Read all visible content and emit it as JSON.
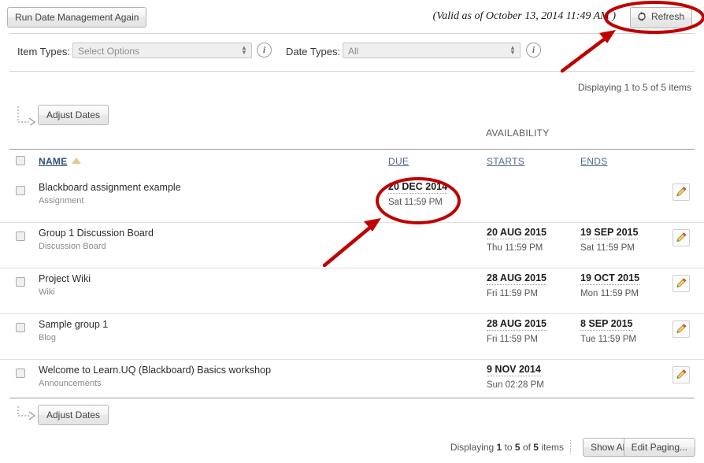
{
  "toolbar": {
    "run_again_label": "Run Date Management Again",
    "valid_as_of": "(Valid as of October 13, 2014 11:49 AM )",
    "refresh_label": "Refresh",
    "refresh_icon": "refresh-circular-arrows-icon"
  },
  "filters": {
    "item_types_label": "Item Types:",
    "item_types_value": "Select Options",
    "date_types_label": "Date Types:",
    "date_types_value": "All",
    "info_icon": "information-icon"
  },
  "paging": {
    "top_text": "Displaying 1 to 5 of 5 items",
    "bottom_prefix": "Displaying ",
    "bottom_from": "1",
    "bottom_mid": " to ",
    "bottom_to": "5",
    "bottom_mid2": " of ",
    "bottom_total": "5",
    "bottom_suffix": " items",
    "show_all_label": "Show All",
    "edit_paging_label": "Edit Paging..."
  },
  "actions": {
    "adjust_dates_label": "Adjust Dates",
    "elbow_icon": "dotted-elbow-arrow-icon",
    "edit_icon": "pencil-edit-icon"
  },
  "table": {
    "group_header": "AVAILABILITY",
    "columns": {
      "name": "NAME",
      "due": "DUE",
      "starts": "STARTS",
      "ends": "ENDS"
    },
    "sort_icon": "sort-ascending-triangle-icon",
    "rows": [
      {
        "title": "Blackboard assignment example",
        "type": "Assignment",
        "due_date": "20 DEC 2014",
        "due_time": "Sat 11:59 PM",
        "starts_date": "",
        "starts_time": "",
        "ends_date": "",
        "ends_time": ""
      },
      {
        "title": "Group 1 Discussion Board",
        "type": "Discussion Board",
        "due_date": "",
        "due_time": "",
        "starts_date": "20 AUG 2015",
        "starts_time": "Thu 11:59 PM",
        "ends_date": "19 SEP 2015",
        "ends_time": "Sat 11:59 PM"
      },
      {
        "title": "Project Wiki",
        "type": "Wiki",
        "due_date": "",
        "due_time": "",
        "starts_date": "28 AUG 2015",
        "starts_time": "Fri 11:59 PM",
        "ends_date": "19 OCT 2015",
        "ends_time": "Mon 11:59 PM"
      },
      {
        "title": "Sample group 1",
        "type": "Blog",
        "due_date": "",
        "due_time": "",
        "starts_date": "28 AUG 2015",
        "starts_time": "Fri 11:59 PM",
        "ends_date": "8 SEP 2015",
        "ends_time": "Tue 11:59 PM"
      },
      {
        "title": "Welcome to Learn.UQ (Blackboard) Basics workshop",
        "type": "Announcements",
        "due_date": "",
        "due_time": "",
        "starts_date": "9 NOV 2014",
        "starts_time": "Sun 02:28 PM",
        "ends_date": "",
        "ends_time": ""
      }
    ]
  },
  "annotations": {
    "color": "#C00000",
    "highlight_refresh": "red-ellipse-around-refresh-button",
    "highlight_due_date": "red-ellipse-around-due-date",
    "arrow_to_refresh": "red-arrow-pointing-to-refresh",
    "arrow_to_due_date": "red-arrow-pointing-to-due-date"
  }
}
